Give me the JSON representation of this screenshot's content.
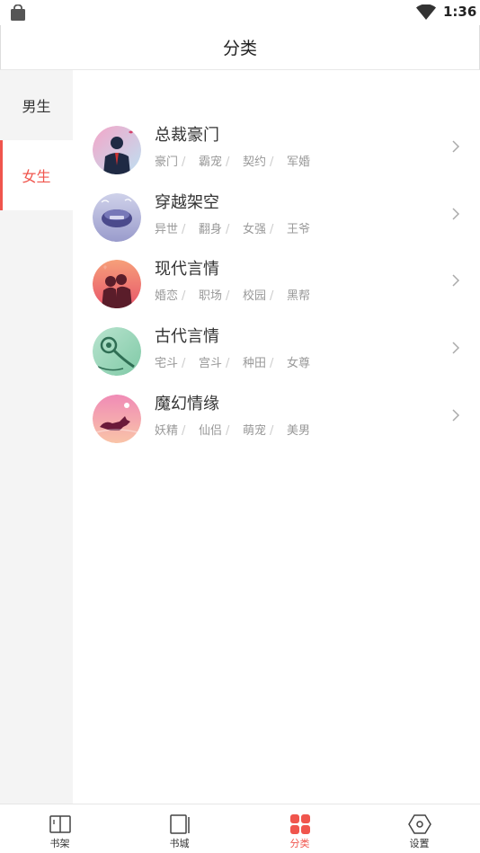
{
  "status_bar": {
    "time": "1:36"
  },
  "header": {
    "title": "分类"
  },
  "sidebar": {
    "items": [
      {
        "label": "男生",
        "selected": false
      },
      {
        "label": "女生",
        "selected": true
      }
    ]
  },
  "categories": [
    {
      "name": "总裁豪门",
      "icon": "ceo-icon",
      "tags": [
        "豪门",
        "霸宠",
        "契约",
        "军婚"
      ]
    },
    {
      "name": "穿越架空",
      "icon": "time-travel-icon",
      "tags": [
        "异世",
        "翻身",
        "女强",
        "王爷"
      ]
    },
    {
      "name": "现代言情",
      "icon": "couple-icon",
      "tags": [
        "婚恋",
        "职场",
        "校园",
        "黑帮"
      ]
    },
    {
      "name": "古代言情",
      "icon": "jade-pendant-icon",
      "tags": [
        "宅斗",
        "宫斗",
        "种田",
        "女尊"
      ]
    },
    {
      "name": "魔幻情缘",
      "icon": "fox-icon",
      "tags": [
        "妖精",
        "仙侣",
        "萌宠",
        "美男"
      ]
    }
  ],
  "tabbar": {
    "items": [
      {
        "label": "书架",
        "icon": "bookshelf-icon",
        "active": false
      },
      {
        "label": "书城",
        "icon": "bookstore-icon",
        "active": false
      },
      {
        "label": "分类",
        "icon": "category-icon",
        "active": true
      },
      {
        "label": "设置",
        "icon": "settings-icon",
        "active": false
      }
    ]
  },
  "colors": {
    "accent": "#f0554d",
    "sidebar_bg": "#f4f4f4",
    "text": "#333333",
    "muted": "#999999"
  }
}
